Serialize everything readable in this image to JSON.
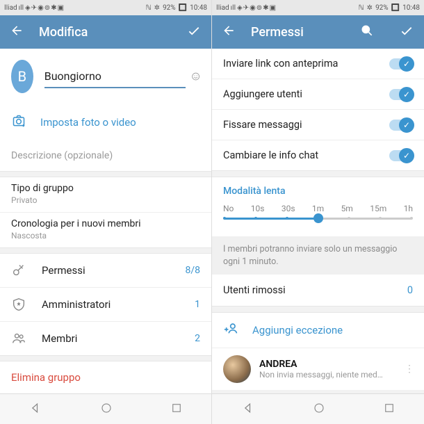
{
  "status": {
    "carrier": "Iliad",
    "signal": "ıll",
    "icons": "◈✈◉⊚✱▣",
    "nfc": "ℕ",
    "bt": "✲",
    "battery_pct": "92%",
    "time": "10:48"
  },
  "left": {
    "header_title": "Modifica",
    "avatar_letter": "B",
    "group_name": "Buongiorno",
    "set_photo_label": "Imposta foto o video",
    "description_placeholder": "Descrizione (opzionale)",
    "group_type_label": "Tipo di gruppo",
    "group_type_value": "Privato",
    "history_label": "Cronologia per i nuovi membri",
    "history_value": "Nascosta",
    "perms_label": "Permessi",
    "perms_value": "8/8",
    "admins_label": "Amministratori",
    "admins_value": "1",
    "members_label": "Membri",
    "members_value": "2",
    "delete_label": "Elimina gruppo"
  },
  "right": {
    "header_title": "Permessi",
    "perm_link": "Inviare link con anteprima",
    "perm_add": "Aggiungere utenti",
    "perm_pin": "Fissare messaggi",
    "perm_info": "Cambiare le info chat",
    "slowmode_title": "Modalità lenta",
    "slowmode_ticks": [
      "No",
      "10s",
      "30s",
      "1m",
      "5m",
      "15m",
      "1h"
    ],
    "slowmode_index": 3,
    "slowmode_info": "I membri potranno inviare solo un messaggio ogni 1 minuto.",
    "removed_label": "Utenti rimossi",
    "removed_value": "0",
    "add_exception": "Aggiungi eccezione",
    "user_name": "ANDREA",
    "user_status": "Non invia messaggi, niente media, ni…"
  }
}
